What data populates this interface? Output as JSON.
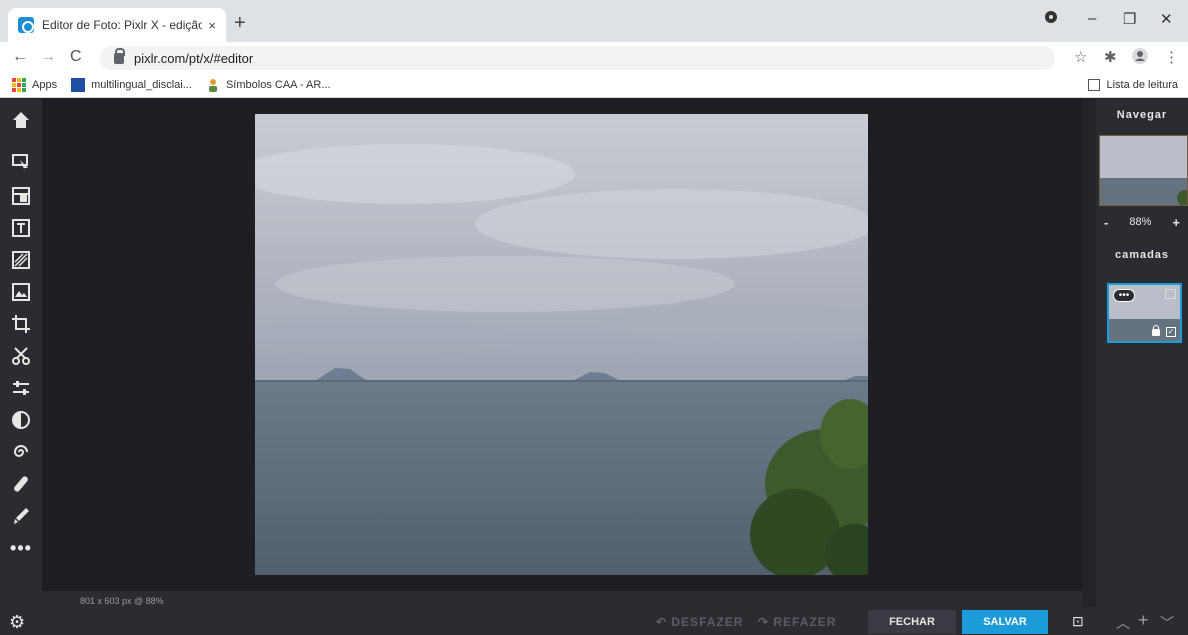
{
  "browser": {
    "tab_title": "Editor de Foto: Pixlr X - edição g",
    "tab_close": "×",
    "new_tab": "+",
    "url": "pixlr.com/pt/x/#editor",
    "nav": {
      "back": "←",
      "forward": "→",
      "reload": "C"
    },
    "window": {
      "minimize": "–",
      "restore": "❐",
      "close": "✕"
    },
    "bookmarks": [
      {
        "label": "Apps"
      },
      {
        "label": "multilingual_disclai..."
      },
      {
        "label": "Símbolos CAA - AR..."
      }
    ],
    "reading_list": "Lista de leitura"
  },
  "editor": {
    "status": "801 x 603 px @ 88%",
    "undo_label": "DESFAZER",
    "redo_label": "REFAZER",
    "close_label": "FECHAR",
    "save_label": "SALVAR",
    "navigator": {
      "title": "Navegar",
      "zoom": "88%",
      "minus": "-",
      "plus": "+"
    },
    "layers": {
      "title": "camadas"
    },
    "tools": [
      "home-icon",
      "arrange-icon",
      "layout-icon",
      "text-icon",
      "pattern-icon",
      "image-icon",
      "crop-icon",
      "cutout-icon",
      "adjust-icon",
      "filter-icon",
      "liquify-icon",
      "retouch-icon",
      "draw-icon",
      "more-icon"
    ]
  },
  "colors": {
    "accent": "#1b9cd8",
    "panel": "#2b2c31",
    "canvas_bg": "#1e1f24"
  }
}
